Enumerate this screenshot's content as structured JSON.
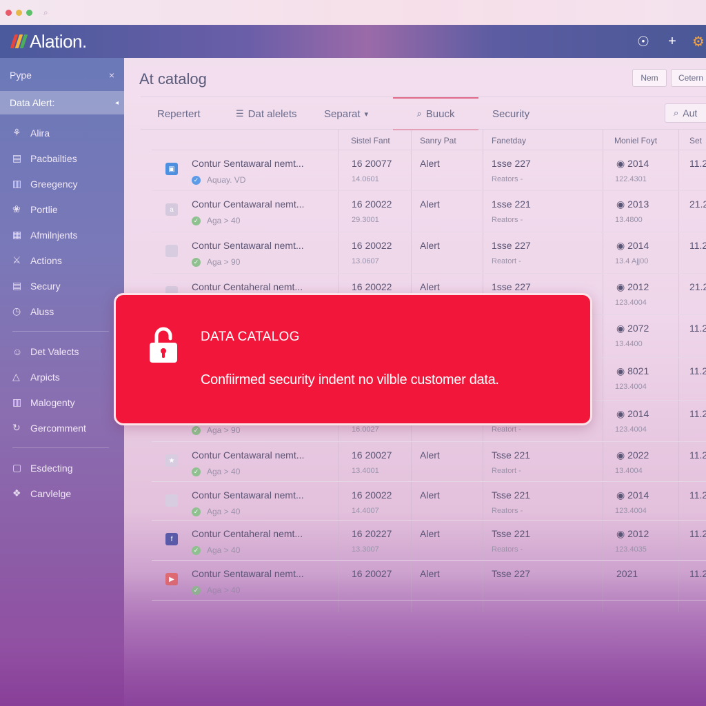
{
  "browser": {
    "search_icon": "⌕"
  },
  "app": {
    "logo_text": "Alation.",
    "logo_colors": [
      "#e8453c",
      "#f3b33d",
      "#4cae5a"
    ],
    "topbar_icons": [
      "☉",
      "+",
      "⚙"
    ]
  },
  "sidebar": {
    "header": "Pype",
    "close": "×",
    "active_item": "Data Alert:",
    "active_chevron": "◂",
    "items": [
      {
        "icon": "⚘",
        "label": "Alira"
      },
      {
        "icon": "▤",
        "label": "Pacbailties"
      },
      {
        "icon": "▥",
        "label": "Greegency"
      },
      {
        "icon": "❀",
        "label": "Portlie"
      },
      {
        "icon": "▦",
        "label": "Afmilnjents"
      },
      {
        "icon": "⚔",
        "label": "Actions"
      },
      {
        "icon": "▤",
        "label": "Secury"
      },
      {
        "icon": "◷",
        "label": "Aluss"
      }
    ],
    "items2": [
      {
        "icon": "☺",
        "label": "Det Valects"
      },
      {
        "icon": "△",
        "label": "Arpicts"
      },
      {
        "icon": "▥",
        "label": "Malogenty"
      },
      {
        "icon": "↻",
        "label": "Gercomment"
      }
    ],
    "items3": [
      {
        "icon": "▢",
        "label": "Esdecting"
      },
      {
        "icon": "❖",
        "label": "Carvlelge"
      }
    ]
  },
  "main": {
    "title": "At catalog",
    "buttons": [
      "Nem",
      "Cetern"
    ],
    "tabs": [
      {
        "label": "Repertert",
        "icon": ""
      },
      {
        "label": "Dat alelets",
        "icon": "☰"
      },
      {
        "label": "Separat",
        "icon": "",
        "chevron": "▾"
      },
      {
        "label": "Buuck",
        "icon": "⌕"
      },
      {
        "label": "Security",
        "icon": ""
      }
    ],
    "search_label": "Aut",
    "search_icon": "⌕",
    "columns": [
      "Sistel Fant",
      "Sanry Pat",
      "Fanetday",
      "Moniel Foyt",
      "Set"
    ]
  },
  "rows": [
    {
      "icon": "▣",
      "icon_color": "#4f8fe0",
      "name": "Contur Sentawaral nemt...",
      "sub_icon": "✓",
      "sub_color": "#5c9be8",
      "sub": "Aquay. VD",
      "id": "16 20077",
      "id2": "14.0601",
      "type": "Alert",
      "issue": "1sse 227",
      "status": "Reators -",
      "year": "◉ 2014",
      "num": "122.4301",
      "set": "11.2"
    },
    {
      "icon": "a",
      "icon_color": "#d5c9de",
      "name": "Contur Centawaral nemt...",
      "sub_icon": "✓",
      "sub_color": "#8fc08f",
      "sub": "Aga > 40",
      "id": "16 20022",
      "id2": "29.3001",
      "type": "Alert",
      "issue": "1sse 221",
      "status": "Reators -",
      "year": "◉ 2013",
      "num": "13.4800",
      "set": "21.2"
    },
    {
      "icon": "",
      "icon_color": "#d8cce0",
      "name": "Contur Sentawaral nemt...",
      "sub_icon": "✓",
      "sub_color": "#8fc08f",
      "sub": "Aga > 90",
      "id": "16 20022",
      "id2": "13.0607",
      "type": "Alert",
      "issue": "1sse 227",
      "status": "Reatort -",
      "year": "◉ 2014",
      "num": "13.4 Ajj00",
      "set": "11.2"
    },
    {
      "icon": "",
      "icon_color": "#d8cce0",
      "name": "Contur Centaheral nemt...",
      "sub_icon": "",
      "sub_color": "#8fc08f",
      "sub": "",
      "id": "16 20022",
      "id2": "",
      "type": "Alert",
      "issue": "1sse 227",
      "status": "",
      "year": "◉ 2012",
      "num": "123.4004",
      "set": "21.2"
    },
    {
      "icon": "",
      "icon_color": "#d8cce0",
      "name": "",
      "sub_icon": "",
      "sub_color": "#8fc08f",
      "sub": "",
      "id": "",
      "id2": "",
      "type": "",
      "issue": "",
      "status": "",
      "year": "◉ 2072",
      "num": "13.4400",
      "set": "11.2"
    },
    {
      "icon": "",
      "icon_color": "#d8cce0",
      "name": "",
      "sub_icon": "",
      "sub_color": "#8fc08f",
      "sub": "",
      "id": "",
      "id2": "",
      "type": "",
      "issue": "",
      "status": "",
      "year": "◉ 8021",
      "num": "123.4004",
      "set": "11.2"
    },
    {
      "icon": "",
      "icon_color": "#d8cce0",
      "name": "",
      "sub_icon": "✓",
      "sub_color": "#8fc08f",
      "sub": "Aga > 90",
      "id": "",
      "id2": "16.0027",
      "type": "",
      "issue": "",
      "status": "Reatort -",
      "year": "◉ 2014",
      "num": "123.4004",
      "set": "11.2"
    },
    {
      "icon": "★",
      "icon_color": "#d8cce0",
      "name": "Contur Centawaral nemt...",
      "sub_icon": "✓",
      "sub_color": "#8fc08f",
      "sub": "Aga > 40",
      "id": "16 20027",
      "id2": "13.4001",
      "type": "Alert",
      "issue": "Tsse 221",
      "status": "Reatort -",
      "year": "◉ 2022",
      "num": "13.4004",
      "set": "11.2"
    },
    {
      "icon": "",
      "icon_color": "#d8cce0",
      "name": "Contur Sentawaral nemt...",
      "sub_icon": "✓",
      "sub_color": "#8fc08f",
      "sub": "Aga > 40",
      "id": "16 20022",
      "id2": "14.4007",
      "type": "Alert",
      "issue": "Tsse 221",
      "status": "Reators -",
      "year": "◉ 2014",
      "num": "123.4004",
      "set": "11.2"
    },
    {
      "icon": "f",
      "icon_color": "#5a5aa8",
      "name": "Contur Centaheral nemt...",
      "sub_icon": "✓",
      "sub_color": "#8fc08f",
      "sub": "Aga > 40",
      "id": "16 20227",
      "id2": "13.3007",
      "type": "Alert",
      "issue": "Tsse 221",
      "status": "Reators -",
      "year": "◉ 2012",
      "num": "123.4035",
      "set": "11.2"
    },
    {
      "icon": "▶",
      "icon_color": "#e06a70",
      "name": "Contur Sentawaral nemt...",
      "sub_icon": "✓",
      "sub_color": "#8fc08f",
      "sub": "Aga > 40",
      "id": "16 20027",
      "id2": "",
      "type": "Alert",
      "issue": "Tsse 227",
      "status": "",
      "year": "2021",
      "num": "",
      "set": "11.2"
    }
  ],
  "alert": {
    "title": "DATA CATALOG",
    "message": "Confiirmed security indent no vilble customer data.",
    "color": "#f2163a"
  }
}
